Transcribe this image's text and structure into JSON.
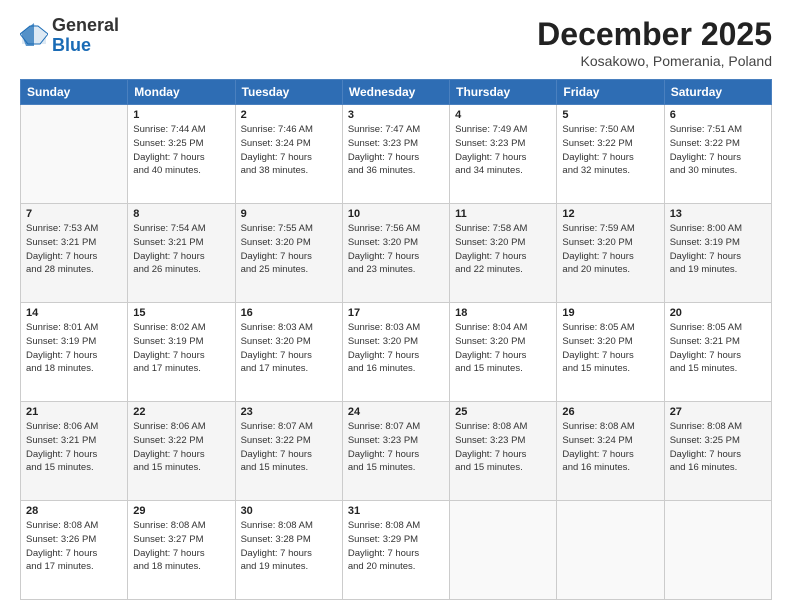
{
  "logo": {
    "general": "General",
    "blue": "Blue"
  },
  "header": {
    "month": "December 2025",
    "location": "Kosakowo, Pomerania, Poland"
  },
  "weekdays": [
    "Sunday",
    "Monday",
    "Tuesday",
    "Wednesday",
    "Thursday",
    "Friday",
    "Saturday"
  ],
  "weeks": [
    [
      {
        "day": "",
        "info": ""
      },
      {
        "day": "1",
        "info": "Sunrise: 7:44 AM\nSunset: 3:25 PM\nDaylight: 7 hours\nand 40 minutes."
      },
      {
        "day": "2",
        "info": "Sunrise: 7:46 AM\nSunset: 3:24 PM\nDaylight: 7 hours\nand 38 minutes."
      },
      {
        "day": "3",
        "info": "Sunrise: 7:47 AM\nSunset: 3:23 PM\nDaylight: 7 hours\nand 36 minutes."
      },
      {
        "day": "4",
        "info": "Sunrise: 7:49 AM\nSunset: 3:23 PM\nDaylight: 7 hours\nand 34 minutes."
      },
      {
        "day": "5",
        "info": "Sunrise: 7:50 AM\nSunset: 3:22 PM\nDaylight: 7 hours\nand 32 minutes."
      },
      {
        "day": "6",
        "info": "Sunrise: 7:51 AM\nSunset: 3:22 PM\nDaylight: 7 hours\nand 30 minutes."
      }
    ],
    [
      {
        "day": "7",
        "info": "Sunrise: 7:53 AM\nSunset: 3:21 PM\nDaylight: 7 hours\nand 28 minutes."
      },
      {
        "day": "8",
        "info": "Sunrise: 7:54 AM\nSunset: 3:21 PM\nDaylight: 7 hours\nand 26 minutes."
      },
      {
        "day": "9",
        "info": "Sunrise: 7:55 AM\nSunset: 3:20 PM\nDaylight: 7 hours\nand 25 minutes."
      },
      {
        "day": "10",
        "info": "Sunrise: 7:56 AM\nSunset: 3:20 PM\nDaylight: 7 hours\nand 23 minutes."
      },
      {
        "day": "11",
        "info": "Sunrise: 7:58 AM\nSunset: 3:20 PM\nDaylight: 7 hours\nand 22 minutes."
      },
      {
        "day": "12",
        "info": "Sunrise: 7:59 AM\nSunset: 3:20 PM\nDaylight: 7 hours\nand 20 minutes."
      },
      {
        "day": "13",
        "info": "Sunrise: 8:00 AM\nSunset: 3:19 PM\nDaylight: 7 hours\nand 19 minutes."
      }
    ],
    [
      {
        "day": "14",
        "info": "Sunrise: 8:01 AM\nSunset: 3:19 PM\nDaylight: 7 hours\nand 18 minutes."
      },
      {
        "day": "15",
        "info": "Sunrise: 8:02 AM\nSunset: 3:19 PM\nDaylight: 7 hours\nand 17 minutes."
      },
      {
        "day": "16",
        "info": "Sunrise: 8:03 AM\nSunset: 3:20 PM\nDaylight: 7 hours\nand 17 minutes."
      },
      {
        "day": "17",
        "info": "Sunrise: 8:03 AM\nSunset: 3:20 PM\nDaylight: 7 hours\nand 16 minutes."
      },
      {
        "day": "18",
        "info": "Sunrise: 8:04 AM\nSunset: 3:20 PM\nDaylight: 7 hours\nand 15 minutes."
      },
      {
        "day": "19",
        "info": "Sunrise: 8:05 AM\nSunset: 3:20 PM\nDaylight: 7 hours\nand 15 minutes."
      },
      {
        "day": "20",
        "info": "Sunrise: 8:05 AM\nSunset: 3:21 PM\nDaylight: 7 hours\nand 15 minutes."
      }
    ],
    [
      {
        "day": "21",
        "info": "Sunrise: 8:06 AM\nSunset: 3:21 PM\nDaylight: 7 hours\nand 15 minutes."
      },
      {
        "day": "22",
        "info": "Sunrise: 8:06 AM\nSunset: 3:22 PM\nDaylight: 7 hours\nand 15 minutes."
      },
      {
        "day": "23",
        "info": "Sunrise: 8:07 AM\nSunset: 3:22 PM\nDaylight: 7 hours\nand 15 minutes."
      },
      {
        "day": "24",
        "info": "Sunrise: 8:07 AM\nSunset: 3:23 PM\nDaylight: 7 hours\nand 15 minutes."
      },
      {
        "day": "25",
        "info": "Sunrise: 8:08 AM\nSunset: 3:23 PM\nDaylight: 7 hours\nand 15 minutes."
      },
      {
        "day": "26",
        "info": "Sunrise: 8:08 AM\nSunset: 3:24 PM\nDaylight: 7 hours\nand 16 minutes."
      },
      {
        "day": "27",
        "info": "Sunrise: 8:08 AM\nSunset: 3:25 PM\nDaylight: 7 hours\nand 16 minutes."
      }
    ],
    [
      {
        "day": "28",
        "info": "Sunrise: 8:08 AM\nSunset: 3:26 PM\nDaylight: 7 hours\nand 17 minutes."
      },
      {
        "day": "29",
        "info": "Sunrise: 8:08 AM\nSunset: 3:27 PM\nDaylight: 7 hours\nand 18 minutes."
      },
      {
        "day": "30",
        "info": "Sunrise: 8:08 AM\nSunset: 3:28 PM\nDaylight: 7 hours\nand 19 minutes."
      },
      {
        "day": "31",
        "info": "Sunrise: 8:08 AM\nSunset: 3:29 PM\nDaylight: 7 hours\nand 20 minutes."
      },
      {
        "day": "",
        "info": ""
      },
      {
        "day": "",
        "info": ""
      },
      {
        "day": "",
        "info": ""
      }
    ]
  ]
}
